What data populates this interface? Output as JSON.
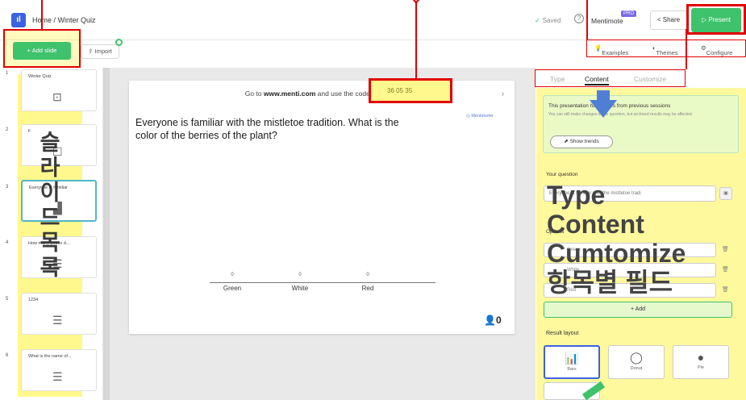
{
  "header": {
    "logo": "ıl",
    "breadcrumb": "Home / Winter Quiz",
    "saved": "Saved",
    "brand": "Mentimote",
    "pro_badge": "PRO",
    "share": "Share",
    "present": "Present"
  },
  "left_toolbar": {
    "add_slide": "+ Add slide",
    "import": "Import"
  },
  "edit_toolbar": {
    "examples": "Examples",
    "themes": "Themes",
    "configure": "Configure"
  },
  "slides": [
    {
      "num": "1",
      "label": "Winter Quiz",
      "icon": "⊡"
    },
    {
      "num": "2",
      "label": "F",
      "icon": "☐"
    },
    {
      "num": "3",
      "label": "Everyone is familiar",
      "icon": "▟"
    },
    {
      "num": "4",
      "label": "How many points d...",
      "icon": "☰"
    },
    {
      "num": "5",
      "label": "1234",
      "icon": "☰"
    },
    {
      "num": "6",
      "label": "What is the name of...",
      "icon": "☰"
    }
  ],
  "sidebar_annotation": "슬라이드목록",
  "slide_preview": {
    "goto_pre": "Go to ",
    "goto_url": "www.menti.com",
    "goto_post": " and use the code ",
    "code": "36 05 35",
    "question": "Everyone is familiar with the mistletoe tradition. What is the color of the berries of the plant?",
    "watermark": "Mentimeter",
    "participants": "0"
  },
  "chart_data": {
    "type": "bar",
    "categories": [
      "Green",
      "White",
      "Red"
    ],
    "values": [
      0,
      0,
      0
    ],
    "title": "",
    "xlabel": "",
    "ylabel": ""
  },
  "right_panel": {
    "tabs": [
      "Type",
      "Content",
      "Customize"
    ],
    "active_tab": "Content",
    "info_title": "This presentation has results from previous sessions",
    "info_sub": "You can still make changes to the question, but archived results may be affected.",
    "show_trends": "Show trends",
    "question_label": "Your question",
    "question_value": "Everyone is familiar with the mistletoe tradi",
    "options_label": "Options",
    "options": [
      "Green",
      "White",
      "Red"
    ],
    "add_option": "+ Add",
    "layout_label": "Result layout",
    "layouts": [
      "Bars",
      "Donut",
      "Pie"
    ]
  },
  "overlay_annotation": [
    "Type",
    "Content",
    "Cumtomize",
    "항목별 필드"
  ],
  "colors": {
    "accent_green": "#3ec26b",
    "annotation_red": "#e00000",
    "highlight_yellow": "#fff000",
    "logo_blue": "#3b62e0"
  }
}
